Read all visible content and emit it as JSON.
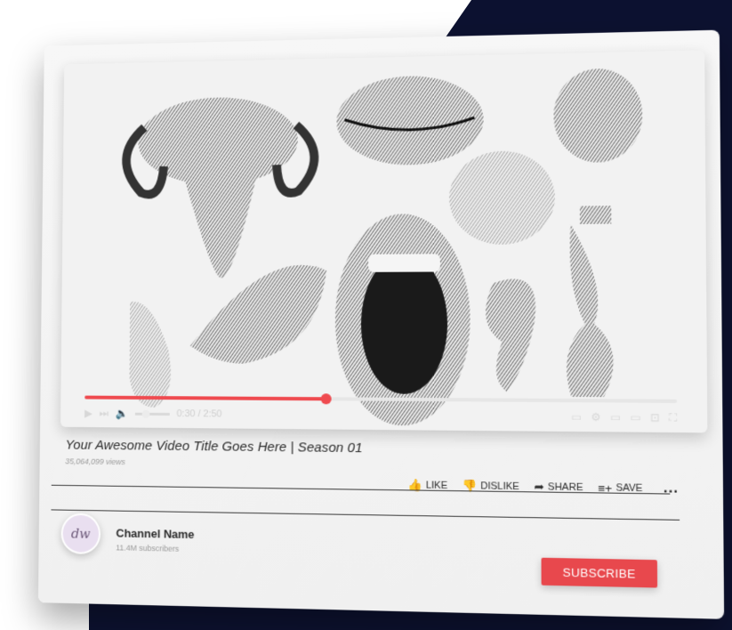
{
  "video": {
    "progress": 0.42,
    "time_text": "0:30 / 2:50"
  },
  "info": {
    "title": "Your Awesome Video Title Goes Here | Season 01",
    "views": "35,064,099 views"
  },
  "actions": {
    "like": "LIKE",
    "dislike": "DISLIKE",
    "share": "SHARE",
    "save": "SAVE",
    "more": "..."
  },
  "channel": {
    "name": "Channel Name",
    "subscribers": "11.4M subscribers",
    "avatar_text": "dw",
    "subscribe_label": "SUBSCRIBE"
  },
  "colors": {
    "accent": "#ef4a4f",
    "navy": "#0c1130"
  }
}
